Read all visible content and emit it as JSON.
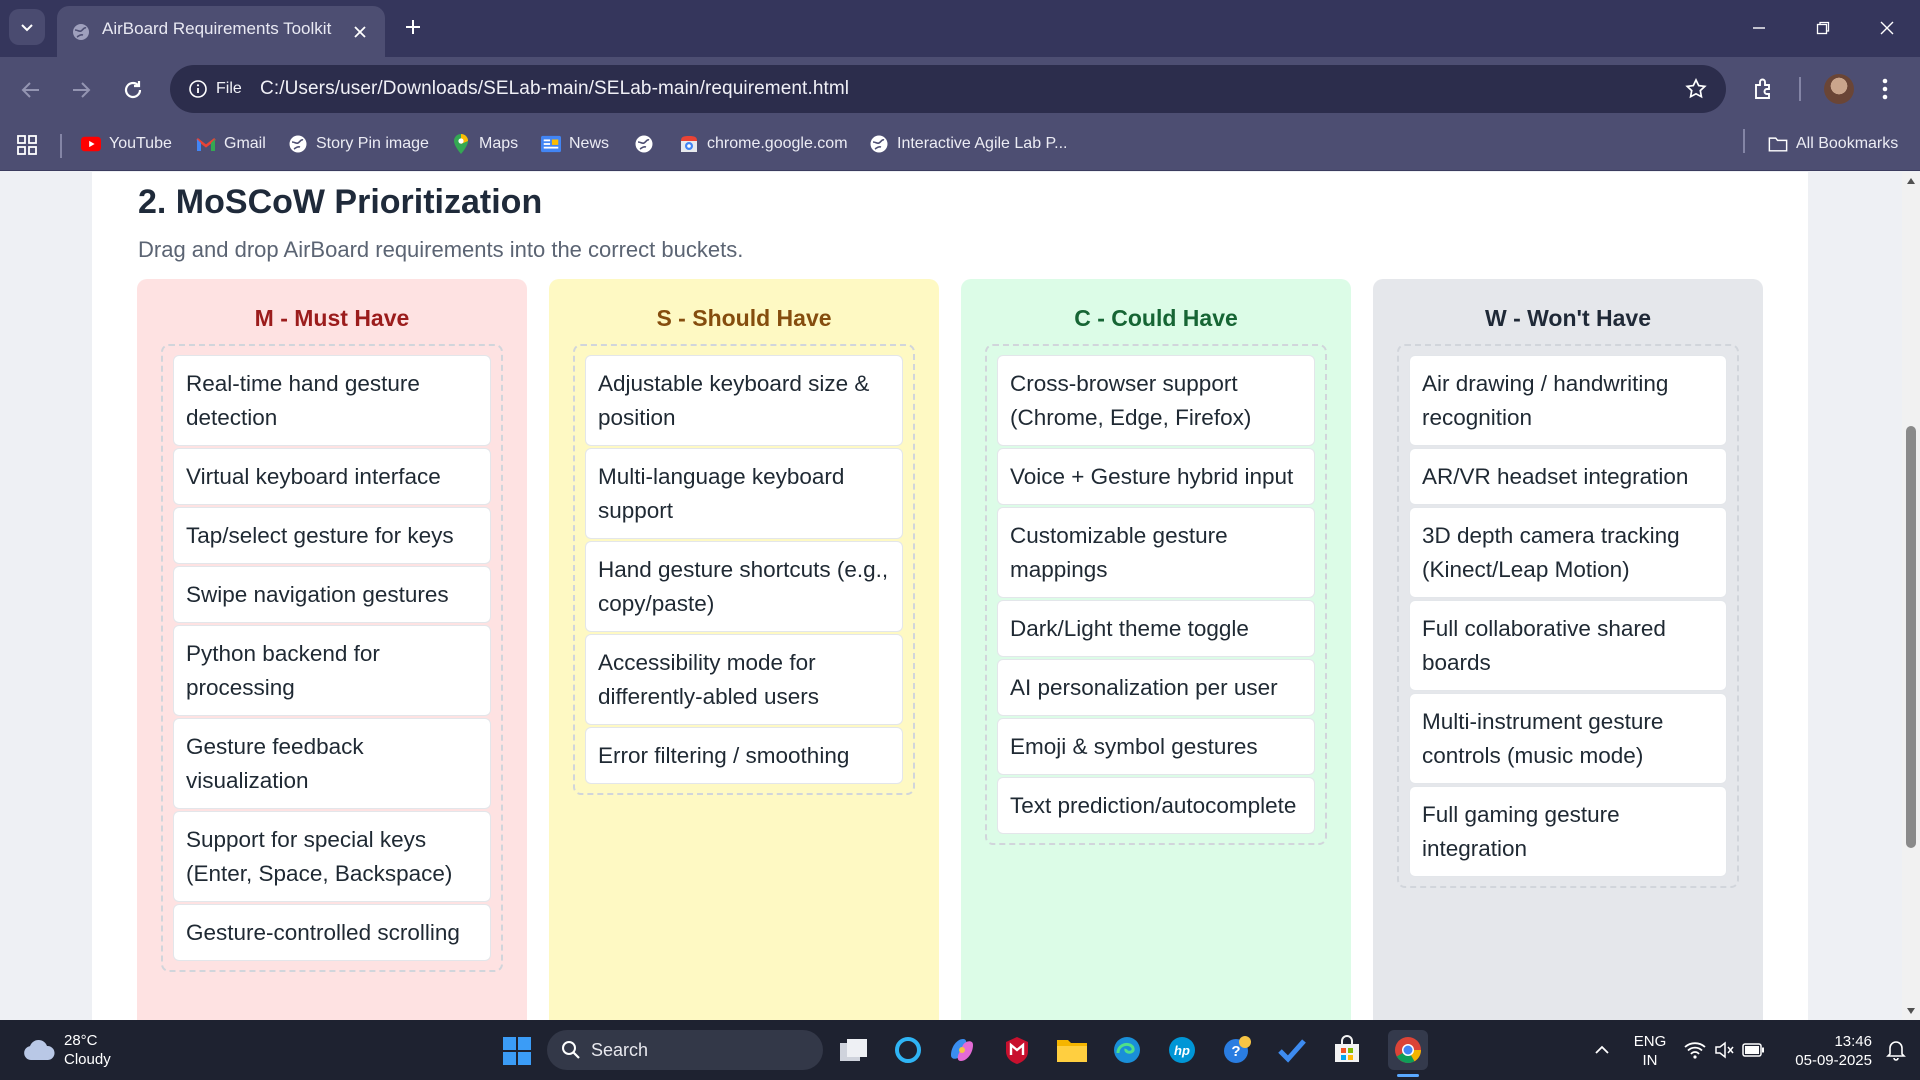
{
  "browser": {
    "tab_title": "AirBoard Requirements Toolkit",
    "site_chip": "File",
    "url": "C:/Users/user/Downloads/SELab-main/SELab-main/requirement.html",
    "bookmarks": [
      {
        "label": "YouTube",
        "icon": "youtube-icon"
      },
      {
        "label": "Gmail",
        "icon": "gmail-icon"
      },
      {
        "label": "Story Pin image",
        "icon": "globe-icon"
      },
      {
        "label": "Maps",
        "icon": "maps-icon"
      },
      {
        "label": "News",
        "icon": "news-icon"
      },
      {
        "label": "",
        "icon": "globe-icon"
      },
      {
        "label": "chrome.google.com",
        "icon": "chrome-web-store-icon"
      },
      {
        "label": "Interactive Agile Lab P...",
        "icon": "globe-icon"
      }
    ],
    "all_bookmarks": "All Bookmarks"
  },
  "page": {
    "section_title": "2. MoSCoW Prioritization",
    "section_subtitle": "Drag and drop AirBoard requirements into the correct buckets.",
    "buckets": [
      {
        "title": "M - Must Have",
        "title_color": "#9b1c1c",
        "bg_color": "#fee2e2",
        "items": [
          "Real-time hand gesture detection",
          "Virtual keyboard interface",
          "Tap/select gesture for keys",
          "Swipe navigation gestures",
          "Python backend for processing",
          "Gesture feedback visualization",
          "Support for special keys (Enter, Space, Backspace)",
          "Gesture-controlled scrolling"
        ]
      },
      {
        "title": "S - Should Have",
        "title_color": "#854d0e",
        "bg_color": "#fef9c3",
        "items": [
          "Adjustable keyboard size & position",
          "Multi-language keyboard support",
          "Hand gesture shortcuts (e.g., copy/paste)",
          "Accessibility mode for differently-abled users",
          "Error filtering / smoothing"
        ]
      },
      {
        "title": "C - Could Have",
        "title_color": "#166534",
        "bg_color": "#dcfce7",
        "items": [
          "Cross-browser support (Chrome, Edge, Firefox)",
          "Voice + Gesture hybrid input",
          "Customizable gesture mappings",
          "Dark/Light theme toggle",
          "AI personalization per user",
          "Emoji & symbol gestures",
          "Text prediction/autocomplete"
        ]
      },
      {
        "title": "W - Won't Have",
        "title_color": "#1f2937",
        "bg_color": "#e5e7eb",
        "items": [
          "Air drawing / handwriting recognition",
          "AR/VR headset integration",
          "3D depth camera tracking (Kinect/Leap Motion)",
          "Full collaborative shared boards",
          "Multi-instrument gesture controls (music mode)",
          "Full gaming gesture integration"
        ]
      }
    ]
  },
  "taskbar": {
    "temperature": "28°C",
    "condition": "Cloudy",
    "search_placeholder": "Search",
    "language": "ENG",
    "region": "IN",
    "time": "13:46",
    "date": "05-09-2025"
  }
}
